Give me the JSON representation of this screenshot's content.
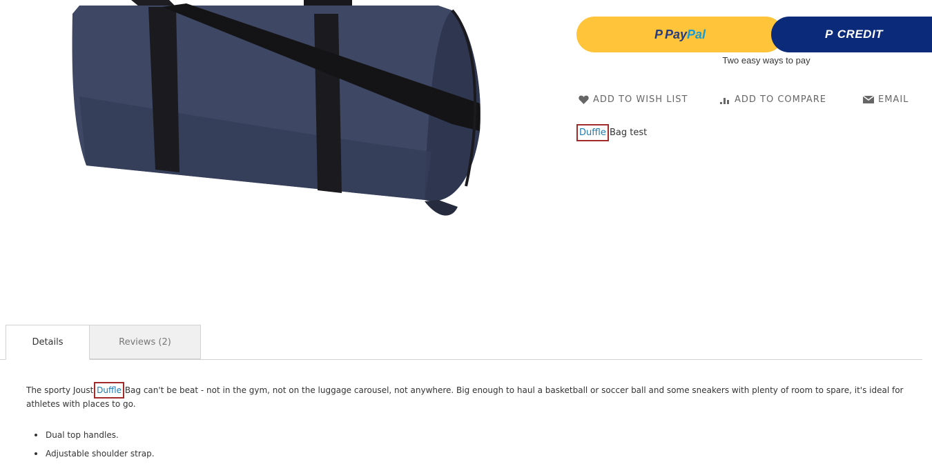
{
  "payment": {
    "paypal_p": "P",
    "paypal_brand_a": "Pay",
    "paypal_brand_b": "Pal",
    "credit_p": "P",
    "credit_label": "CREDIT",
    "tagline": "Two easy ways to pay",
    "colors": {
      "paypal_yellow": "#ffc439",
      "credit_navy": "#0c2a7a"
    }
  },
  "actions": {
    "wishlist": "ADD TO WISH LIST",
    "compare": "ADD TO COMPARE",
    "email": "EMAIL"
  },
  "short_description": {
    "highlight": "Duffle",
    "rest": "Bag test"
  },
  "tabs": [
    {
      "label": "Details",
      "active": true
    },
    {
      "label": "Reviews (2)",
      "active": false
    }
  ],
  "details": {
    "text_before": "The sporty Joust ",
    "highlight": "Duffle",
    "text_after": " Bag can't be beat - not in the gym, not on the luggage carousel, not anywhere. Big enough to haul a basketball or soccer ball and some sneakers with plenty of room to spare, it's ideal for athletes with places to go.",
    "features": [
      "Dual top handles.",
      "Adjustable shoulder strap."
    ]
  }
}
